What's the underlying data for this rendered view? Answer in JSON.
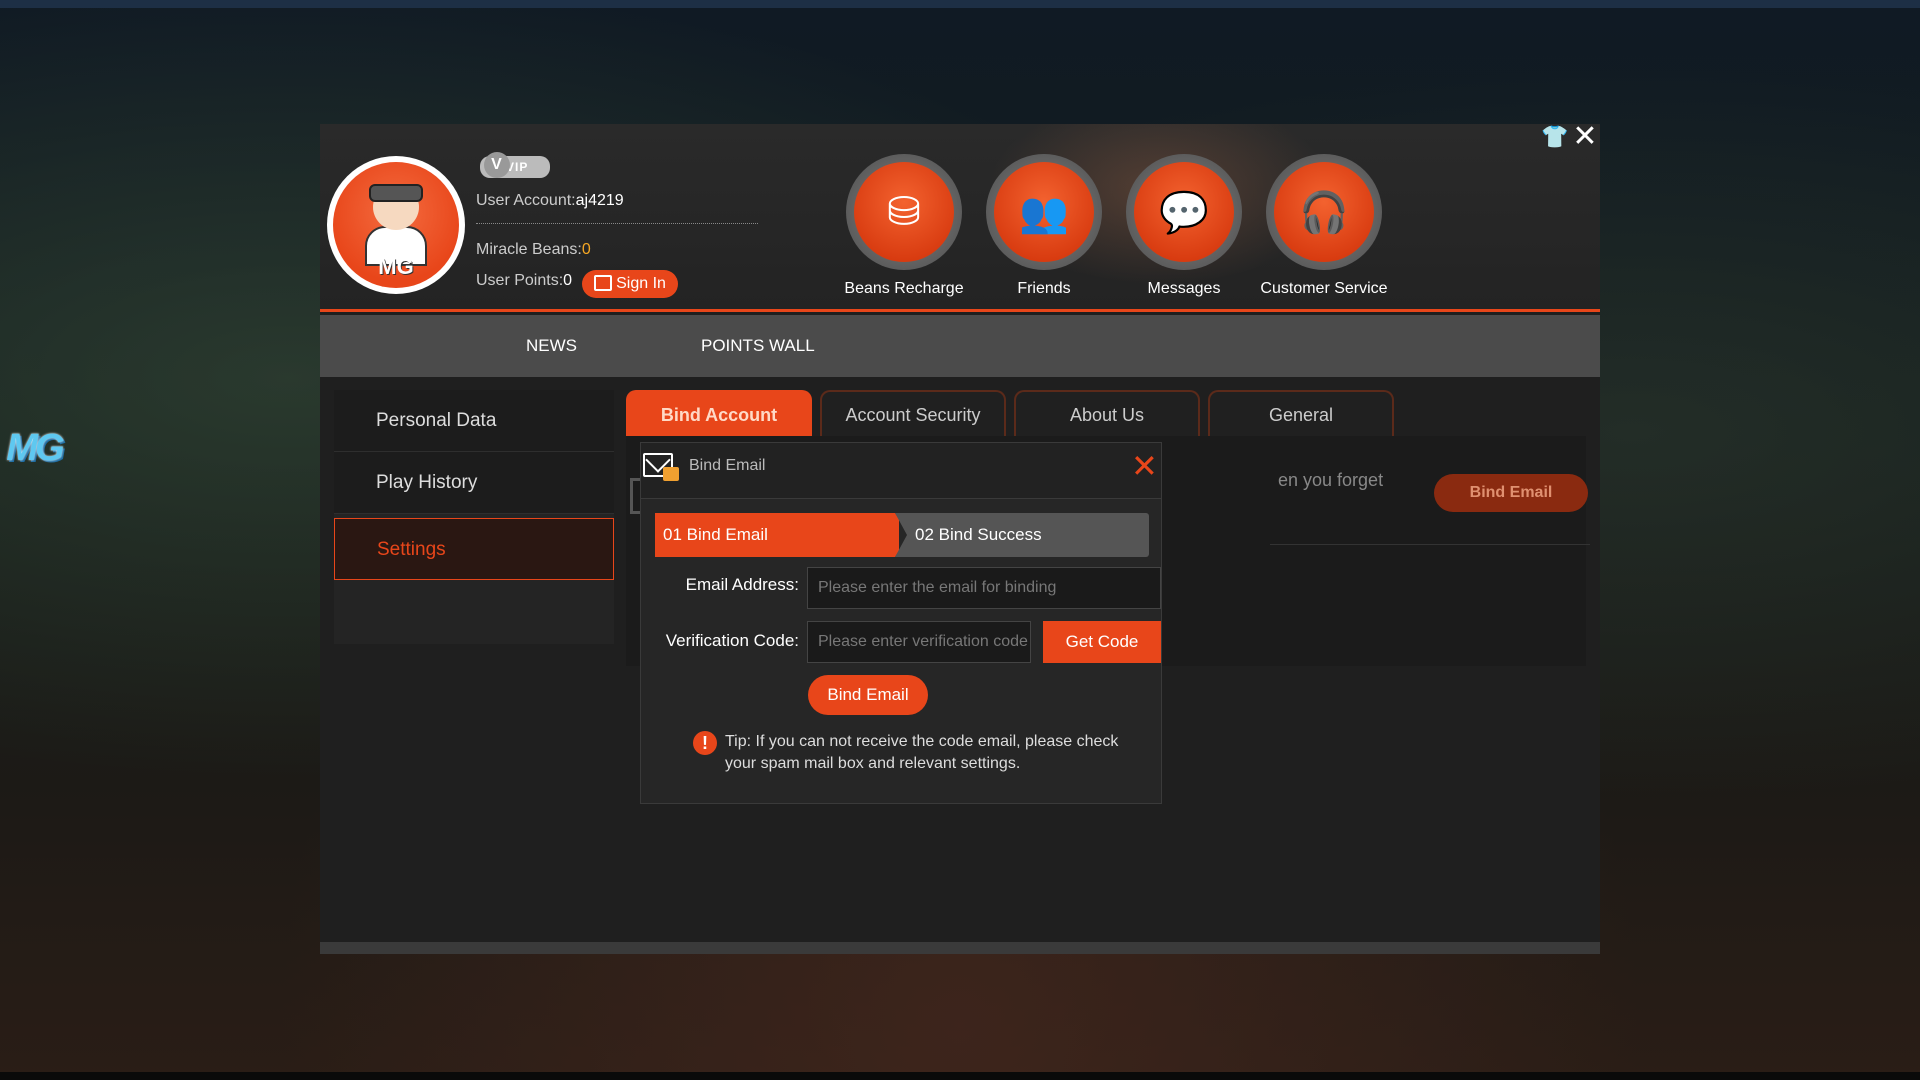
{
  "header": {
    "vip_label": "VIP",
    "account_label": "User Account:",
    "account_value": "aj4219",
    "beans_label": "Miracle Beans:",
    "beans_value": "0",
    "points_label": "User Points:",
    "points_value": "0",
    "signin_label": "Sign In",
    "buttons": [
      {
        "label": "Beans Recharge",
        "icon": "coins-icon"
      },
      {
        "label": "Friends",
        "icon": "friends-icon"
      },
      {
        "label": "Messages",
        "icon": "messages-icon"
      },
      {
        "label": "Customer Service",
        "icon": "headset-icon"
      }
    ]
  },
  "nav": {
    "items": [
      "NEWS",
      "POINTS WALL"
    ]
  },
  "sidebar": {
    "items": [
      "Personal Data",
      "Play History",
      "Settings"
    ],
    "active": "Settings"
  },
  "tabs": {
    "items": [
      "Bind Account",
      "Account Security",
      "About Us",
      "General"
    ],
    "active": "Bind Account"
  },
  "background_panel": {
    "partial_text": "en you forget",
    "button_label": "Bind Email"
  },
  "modal": {
    "title": "Bind Email",
    "step1": "01 Bind Email",
    "step2": "02 Bind Success",
    "email_label": "Email Address:",
    "email_placeholder": "Please enter the email for binding",
    "code_label": "Verification Code:",
    "code_placeholder": "Please enter verification code",
    "get_code_label": "Get Code",
    "bind_label": "Bind Email",
    "tip": "Tip: If you can not receive the code email, please check your spam mail box and relevant settings."
  },
  "avatar_text": "MG",
  "side_logo_text": "MG",
  "colors": {
    "accent": "#e8461a",
    "panel": "#1f1f1f",
    "nav": "#4b4b4b"
  }
}
